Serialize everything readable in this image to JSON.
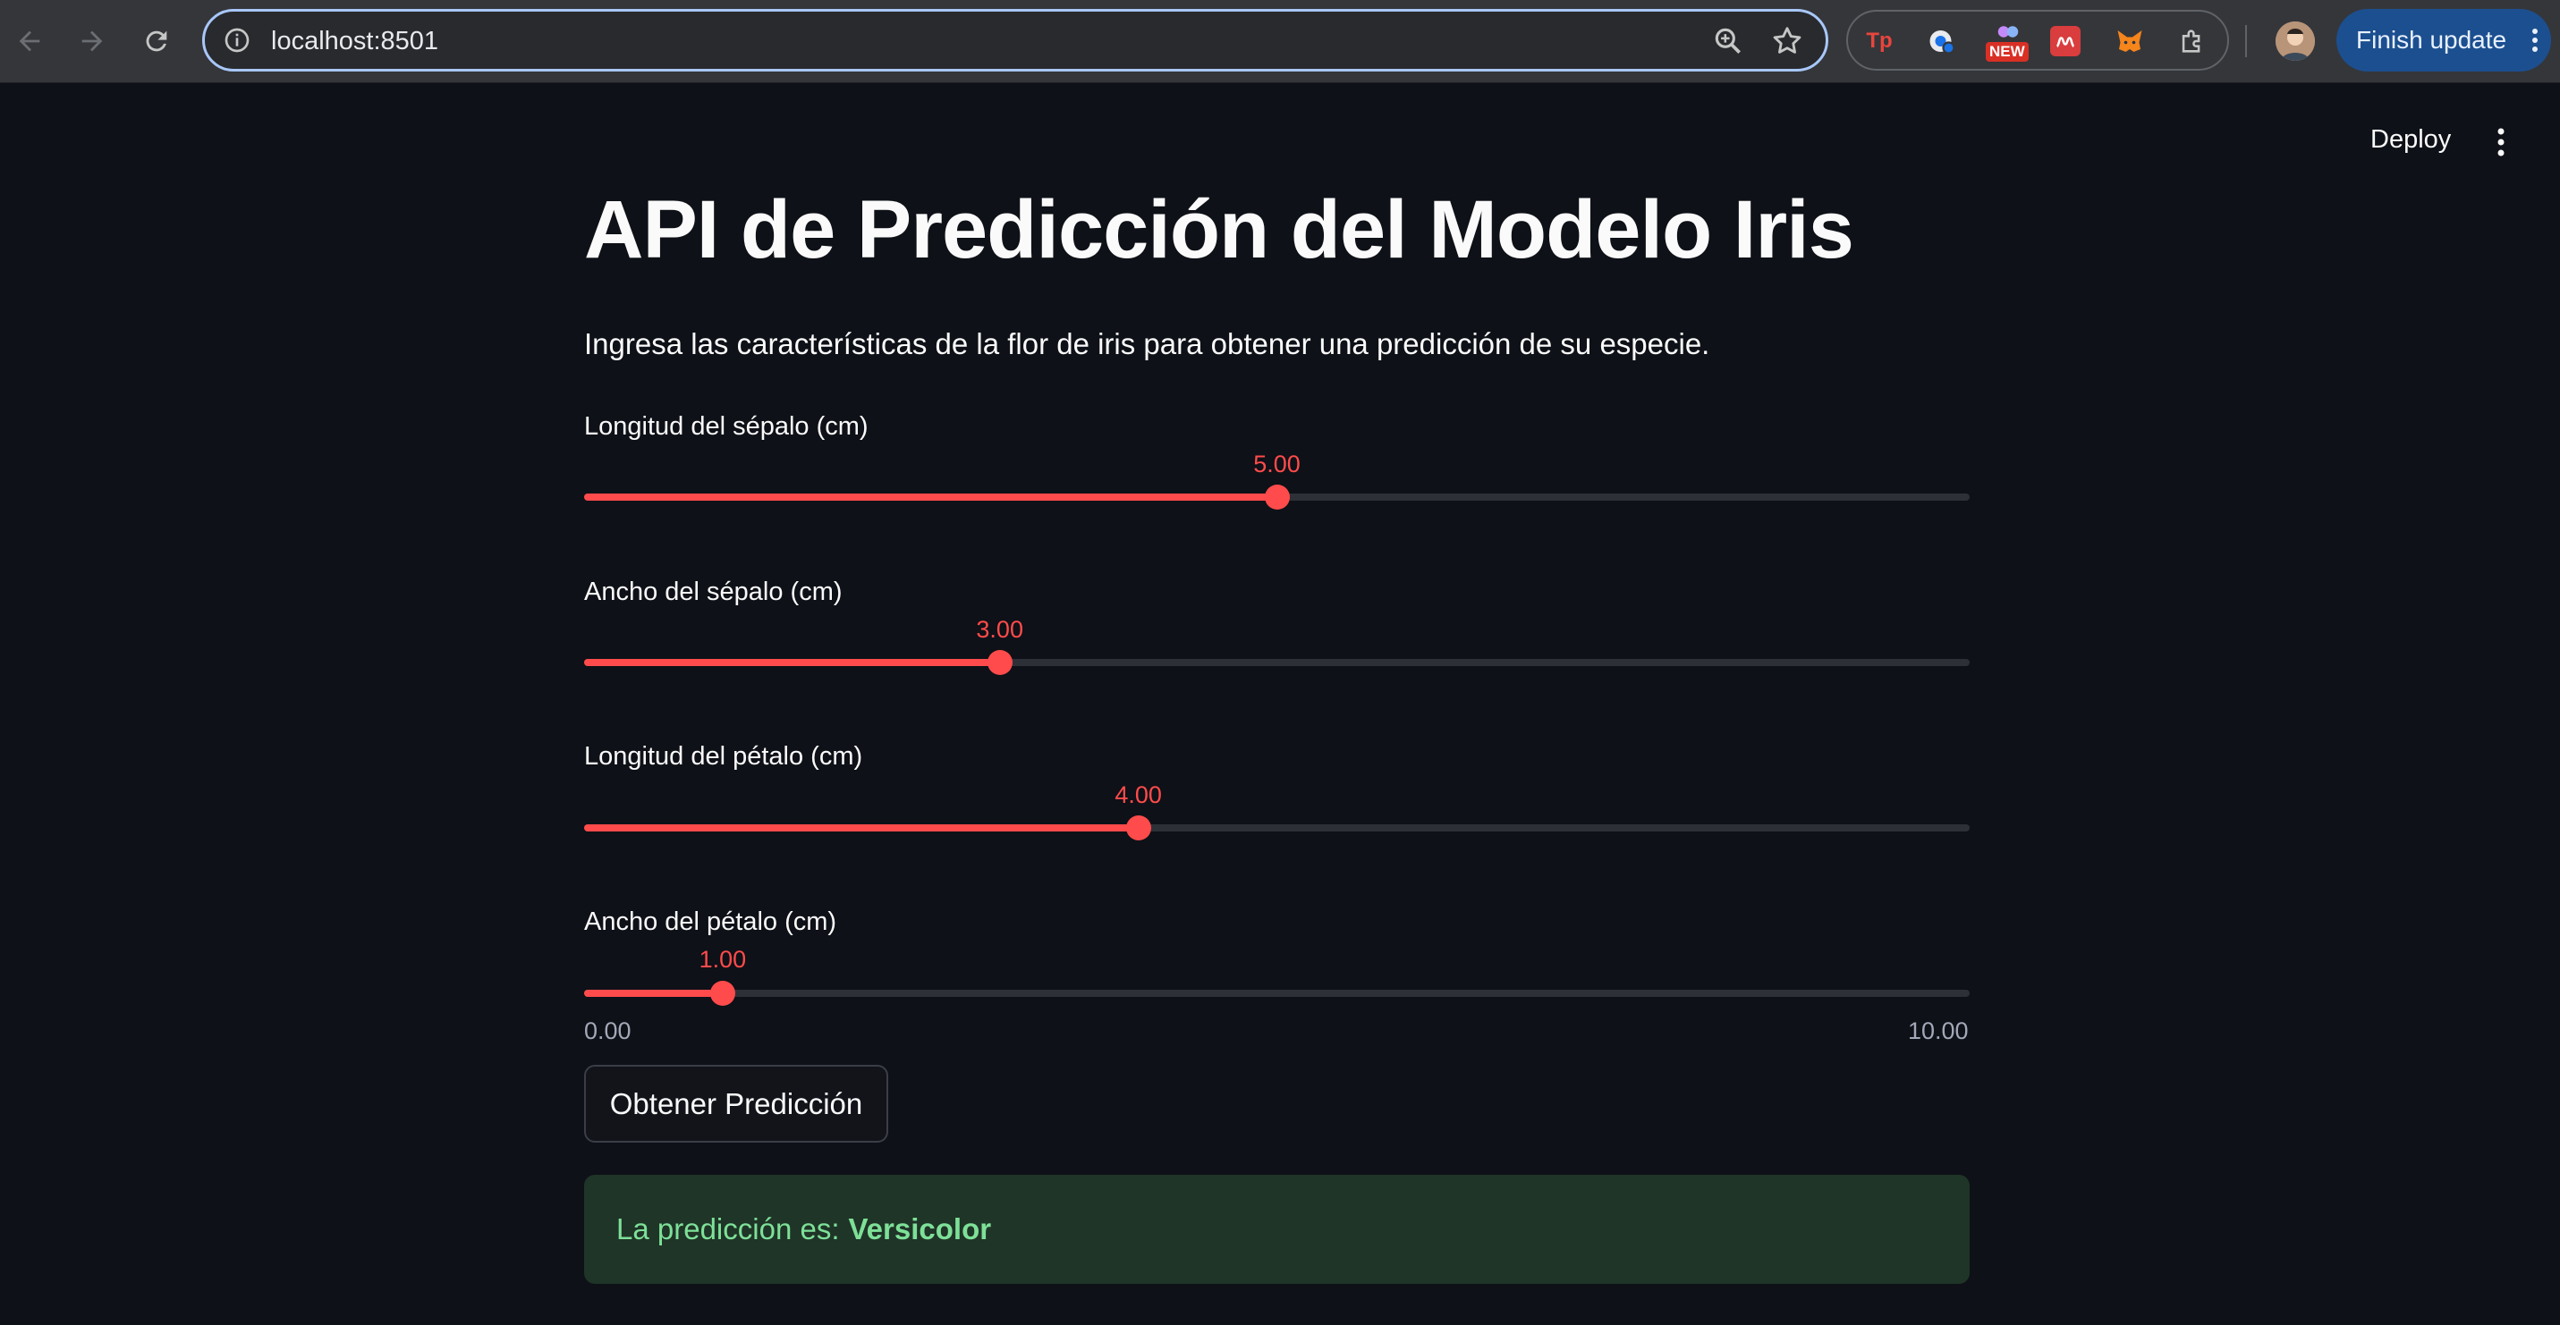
{
  "browser": {
    "url": "localhost:8501",
    "finish_update_label": "Finish update",
    "extensions": [
      "tp-extension-icon",
      "translate-extension-icon",
      "new-badge-extension-icon",
      "mendeley-extension-icon",
      "metamask-extension-icon",
      "puzzle-extensions-icon"
    ],
    "new_badge": "NEW"
  },
  "toolbar": {
    "deploy_label": "Deploy"
  },
  "page": {
    "title": "API de Predicción del Modelo Iris",
    "subtitle": "Ingresa las características de la flor de iris para obtener una predicción de su especie."
  },
  "sliders": [
    {
      "label": "Longitud del sépalo (cm)",
      "value": 5.0,
      "display": "5.00"
    },
    {
      "label": "Ancho del sépalo (cm)",
      "value": 3.0,
      "display": "3.00"
    },
    {
      "label": "Longitud del pétalo (cm)",
      "value": 4.0,
      "display": "4.00"
    },
    {
      "label": "Ancho del pétalo (cm)",
      "value": 1.0,
      "display": "1.00"
    }
  ],
  "slider_range": {
    "min": 0,
    "max": 10,
    "min_label": "0.00",
    "max_label": "10.00"
  },
  "predict_button": "Obtener Predicción",
  "result": {
    "prefix": "La predicción es:",
    "species": "Versicolor"
  },
  "colors": {
    "accent": "#ff4b4b",
    "background": "#0e1117",
    "success_bg": "#1f3527",
    "success_text": "#7ee098"
  }
}
